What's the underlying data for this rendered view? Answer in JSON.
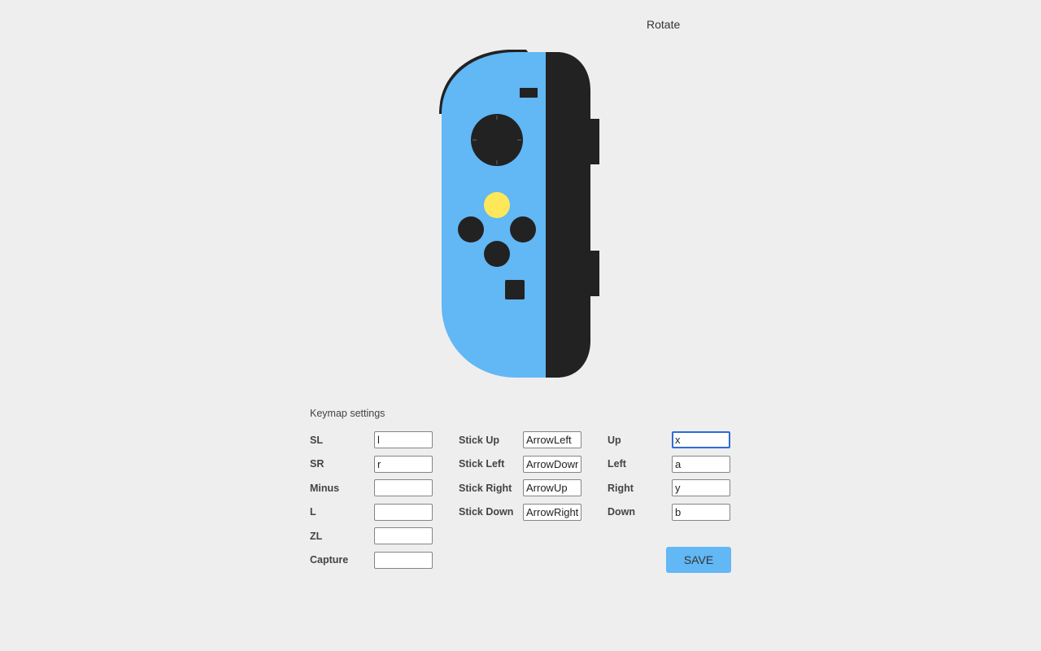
{
  "header": {
    "rotate_label": "Rotate"
  },
  "controller": {
    "body_color": "#62b7f5",
    "rail_color": "#222222",
    "highlight_button_color": "#ffe75a"
  },
  "keymap": {
    "title": "Keymap settings",
    "col1": [
      {
        "label": "SL",
        "value": "l"
      },
      {
        "label": "SR",
        "value": "r"
      },
      {
        "label": "Minus",
        "value": ""
      },
      {
        "label": "L",
        "value": ""
      },
      {
        "label": "ZL",
        "value": ""
      },
      {
        "label": "Capture",
        "value": ""
      }
    ],
    "col2": [
      {
        "label": "Stick Up",
        "value": "ArrowLeft"
      },
      {
        "label": "Stick Left",
        "value": "ArrowDown"
      },
      {
        "label": "Stick Right",
        "value": "ArrowUp"
      },
      {
        "label": "Stick Down",
        "value": "ArrowRight"
      }
    ],
    "col3": [
      {
        "label": "Up",
        "value": "x"
      },
      {
        "label": "Left",
        "value": "a"
      },
      {
        "label": "Right",
        "value": "y"
      },
      {
        "label": "Down",
        "value": "b"
      }
    ],
    "save_label": "SAVE"
  }
}
